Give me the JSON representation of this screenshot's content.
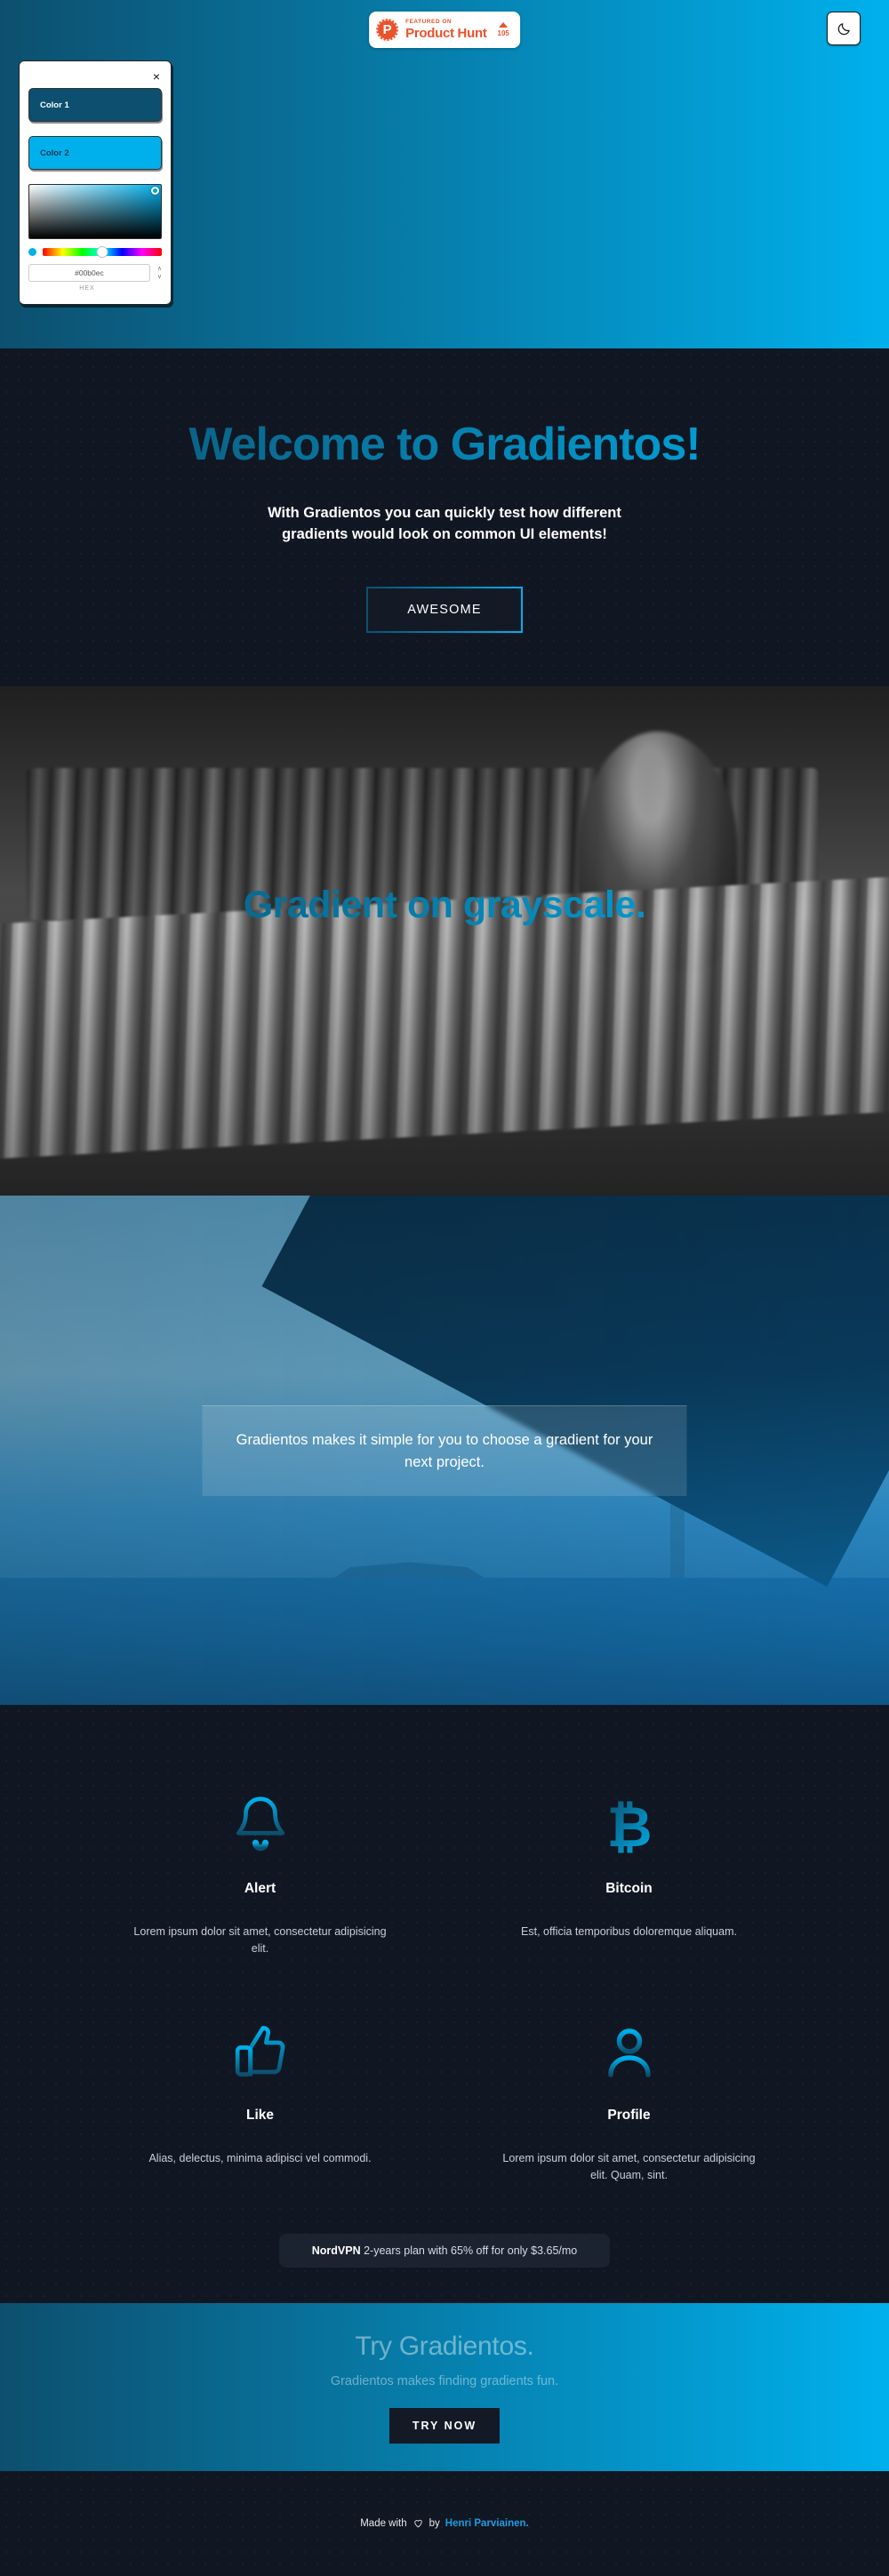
{
  "header": {
    "product_hunt": {
      "featured_label": "FEATURED ON",
      "name": "Product Hunt",
      "upvotes": "105",
      "logo_letter": "P"
    },
    "dark_mode_icon": "moon-icon"
  },
  "color_picker": {
    "close_label": "×",
    "color1_label": "Color 1",
    "color2_label": "Color 2",
    "color1_hex": "#0d4f6e",
    "color2_hex": "#00b0ec",
    "hex_value": "#00b0ec",
    "hex_format_label": "HEX",
    "stepper_up": "∧",
    "stepper_down": "∨"
  },
  "hero": {
    "title": "Welcome to Gradientos!",
    "subtitle": "With Gradientos you can quickly test how different gradients would look on common UI elements!",
    "cta_label": "AWESOME"
  },
  "grayscale_section": {
    "title": "Gradient on grayscale."
  },
  "city_section": {
    "caption": "Gradientos makes it simple for you to choose a gradient for your next project."
  },
  "features": [
    {
      "icon": "bell-icon",
      "title": "Alert",
      "description": "Lorem ipsum dolor sit amet, consectetur adipisicing elit."
    },
    {
      "icon": "bitcoin-icon",
      "title": "Bitcoin",
      "description": "Est, officia temporibus doloremque aliquam."
    },
    {
      "icon": "thumbs-up-icon",
      "title": "Like",
      "description": "Alias, delectus, minima adipisci vel commodi."
    },
    {
      "icon": "user-icon",
      "title": "Profile",
      "description": "Lorem ipsum dolor sit amet, consectetur adipisicing elit. Quam, sint."
    }
  ],
  "nordvpn": {
    "brand": "NordVPN",
    "offer": " 2-years plan with 65% off for only $3.65/mo"
  },
  "cta": {
    "title": "Try Gradientos.",
    "subtitle": "Gradientos makes finding gradients fun.",
    "button_label": "TRY NOW"
  },
  "footer": {
    "made_with": "Made with",
    "heart_icon": "heart-icon",
    "by": "by",
    "author": "Henri Parviainen."
  },
  "theme": {
    "gradient_start": "#0d4f6e",
    "gradient_end": "#00b0ec",
    "dark_bg": "#111722"
  }
}
